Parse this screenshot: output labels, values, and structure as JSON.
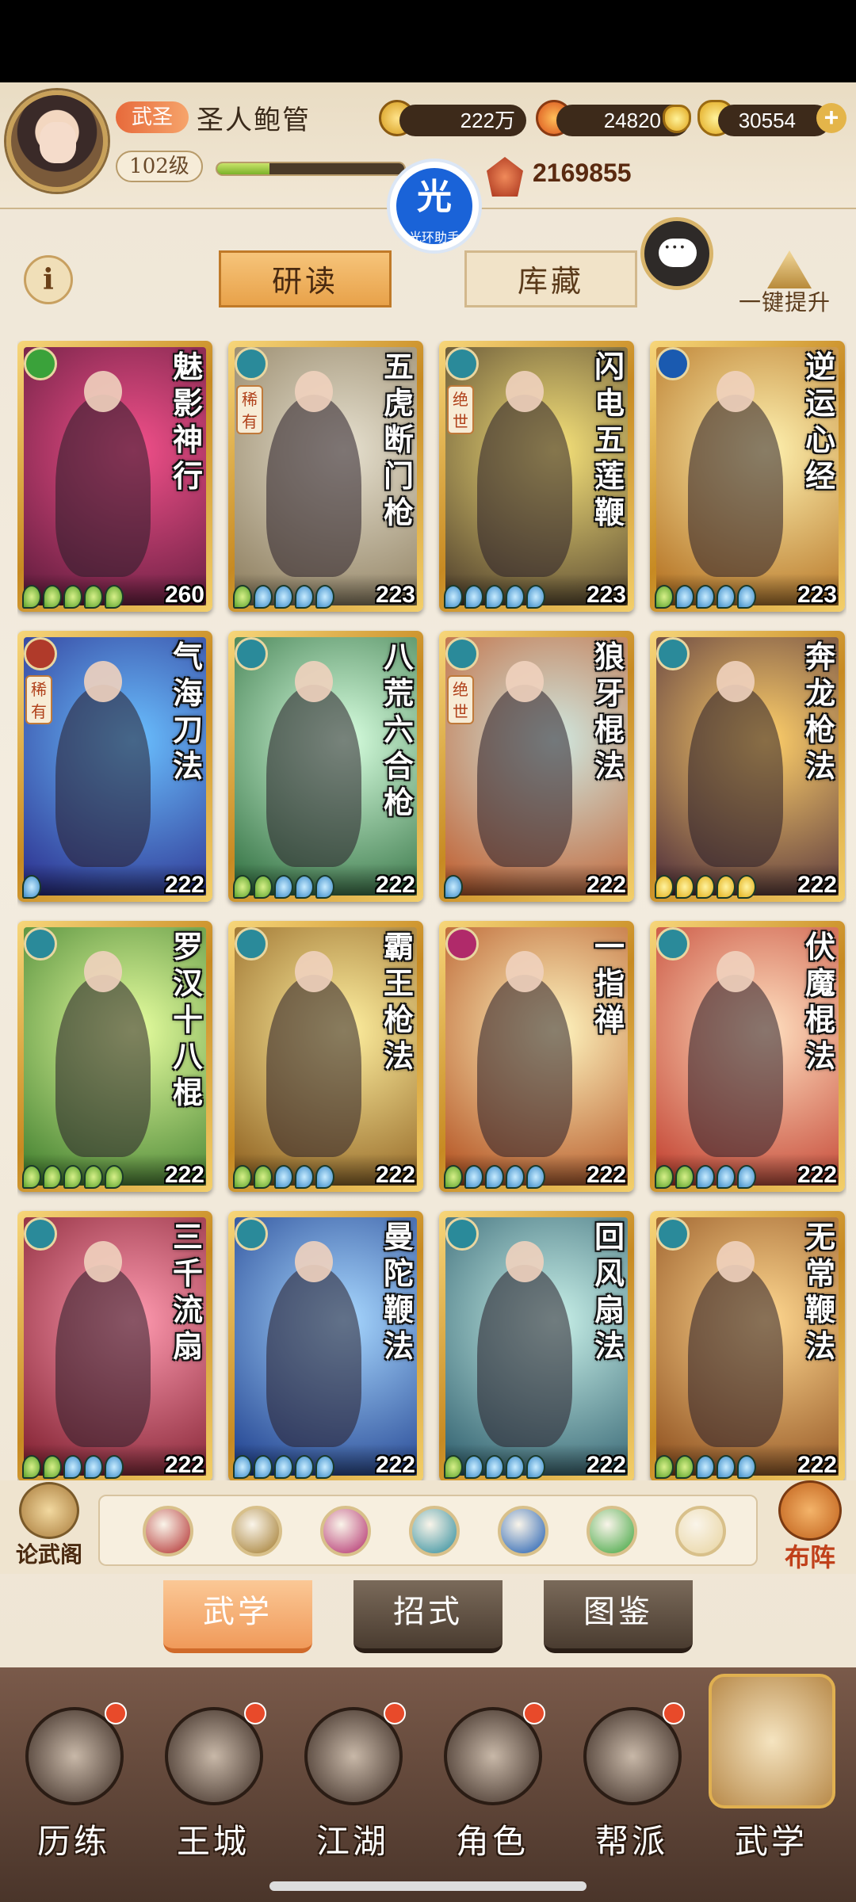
{
  "header": {
    "title_badge": "武圣",
    "player_name": "圣人鲍管",
    "level": "102级",
    "xp_fraction": 0.28,
    "power": "2169855",
    "resources": [
      {
        "icon": "copper-coin-icon",
        "value": "222万"
      },
      {
        "icon": "flame-gem-icon",
        "value": "24820"
      },
      {
        "icon": "gold-ingot-icon",
        "value": "30554"
      }
    ],
    "helper": {
      "glyph": "光",
      "label": "光环助手"
    }
  },
  "tabs": {
    "info_glyph": "i",
    "study": "研读",
    "storage": "库藏",
    "upgrade_label": "一键提升"
  },
  "cards": [
    {
      "name": "魅影神行",
      "type_icon": "qinggong-icon",
      "type_color": "#3aa23a",
      "rarity": "",
      "stars": "ggggg",
      "level": "260",
      "bg": [
        "#f2508a",
        "#5a1a3a"
      ]
    },
    {
      "name": "五虎断门枪",
      "type_icon": "spear-icon",
      "type_color": "#2a8a9a",
      "rarity": "稀有",
      "stars": "gbbbb",
      "level": "223",
      "bg": [
        "#e6e0cf",
        "#8a7a5a"
      ]
    },
    {
      "name": "闪电五莲鞭",
      "type_icon": "whip-icon",
      "type_color": "#2a8a9a",
      "rarity": "绝世",
      "stars": "bbbbb",
      "level": "223",
      "bg": [
        "#f7e37a",
        "#4a3a2a"
      ]
    },
    {
      "name": "逆运心经",
      "type_icon": "taiji-icon",
      "type_color": "#1a5ab0",
      "rarity": "",
      "stars": "gbbbb",
      "level": "223",
      "bg": [
        "#fff2b0",
        "#b06a1a"
      ]
    },
    {
      "name": "气海刀法",
      "type_icon": "saber-icon",
      "type_color": "#b03a2a",
      "rarity": "稀有",
      "stars": "b",
      "level": "222",
      "bg": [
        "#6ac0ff",
        "#2a2a8a"
      ]
    },
    {
      "name": "八荒六合枪",
      "type_icon": "spear-icon",
      "type_color": "#2a8a9a",
      "rarity": "",
      "stars": "ggbbb",
      "level": "222",
      "bg": [
        "#d8ffe0",
        "#2a6a3a"
      ]
    },
    {
      "name": "狼牙棍法",
      "type_icon": "staff-icon",
      "type_color": "#2a8a9a",
      "rarity": "绝世",
      "stars": "b",
      "level": "222",
      "bg": [
        "#cfe8e0",
        "#c05a2a"
      ]
    },
    {
      "name": "奔龙枪法",
      "type_icon": "spear-icon",
      "type_color": "#2a8a9a",
      "rarity": "",
      "stars": "yyyyy",
      "level": "222",
      "bg": [
        "#ffd06a",
        "#4a2a3a"
      ]
    },
    {
      "name": "罗汉十八棍",
      "type_icon": "staff-icon",
      "type_color": "#2a8a9a",
      "rarity": "",
      "stars": "ggggg",
      "level": "222",
      "bg": [
        "#e8ffa0",
        "#3a7a2a"
      ]
    },
    {
      "name": "霸王枪法",
      "type_icon": "spear-icon",
      "type_color": "#2a8a9a",
      "rarity": "",
      "stars": "ggbbb",
      "level": "222",
      "bg": [
        "#fff0a0",
        "#8a5a1a"
      ]
    },
    {
      "name": "一指禅",
      "type_icon": "palm-icon",
      "type_color": "#b02a6a",
      "rarity": "",
      "stars": "gbbbb",
      "level": "222",
      "bg": [
        "#fff6c0",
        "#b04a1a"
      ]
    },
    {
      "name": "伏魔棍法",
      "type_icon": "staff-icon",
      "type_color": "#2a8a9a",
      "rarity": "",
      "stars": "ggbbb",
      "level": "222",
      "bg": [
        "#ffe0c0",
        "#c03a2a"
      ]
    },
    {
      "name": "三千流扇",
      "type_icon": "fan-icon",
      "type_color": "#2a8a9a",
      "rarity": "",
      "stars": "ggbbb",
      "level": "222",
      "bg": [
        "#ff9ab0",
        "#7a1a2a"
      ]
    },
    {
      "name": "曼陀鞭法",
      "type_icon": "whip-icon",
      "type_color": "#2a8a9a",
      "rarity": "",
      "stars": "bbbbb",
      "level": "222",
      "bg": [
        "#a8d8ff",
        "#1a3a8a"
      ]
    },
    {
      "name": "回风扇法",
      "type_icon": "fan-icon",
      "type_color": "#2a8a9a",
      "rarity": "",
      "stars": "gbbbb",
      "level": "222",
      "bg": [
        "#c8f0e8",
        "#2a5a6a"
      ]
    },
    {
      "name": "无常鞭法",
      "type_icon": "whip-icon",
      "type_color": "#2a8a9a",
      "rarity": "",
      "stars": "ggbbb",
      "level": "222",
      "bg": [
        "#ffd890",
        "#8a4a1a"
      ]
    }
  ],
  "filter": {
    "left_label": "论武阁",
    "right_label": "布阵",
    "icons": [
      {
        "name": "saber-filter-icon",
        "color": "#b02a2a"
      },
      {
        "name": "sword-filter-icon",
        "color": "#a0782a"
      },
      {
        "name": "palm-filter-icon",
        "color": "#b02a6a"
      },
      {
        "name": "fan-filter-icon",
        "color": "#2a8a9a"
      },
      {
        "name": "taiji-filter-icon",
        "color": "#1a5ab0"
      },
      {
        "name": "qinggong-filter-icon",
        "color": "#3aa23a"
      },
      {
        "name": "other-filter-icon",
        "color": "#e8d4a0"
      }
    ]
  },
  "subtabs": {
    "martial": "武学",
    "moves": "招式",
    "atlas": "图鉴"
  },
  "nav": [
    {
      "label": "历练",
      "icon": "training-icon",
      "badge": true
    },
    {
      "label": "王城",
      "icon": "city-icon",
      "badge": true
    },
    {
      "label": "江湖",
      "icon": "jianghu-icon",
      "badge": true
    },
    {
      "label": "角色",
      "icon": "character-icon",
      "badge": true
    },
    {
      "label": "帮派",
      "icon": "guild-icon",
      "badge": true
    },
    {
      "label": "武学",
      "icon": "martial-arts-icon",
      "badge": false,
      "active": true
    }
  ]
}
